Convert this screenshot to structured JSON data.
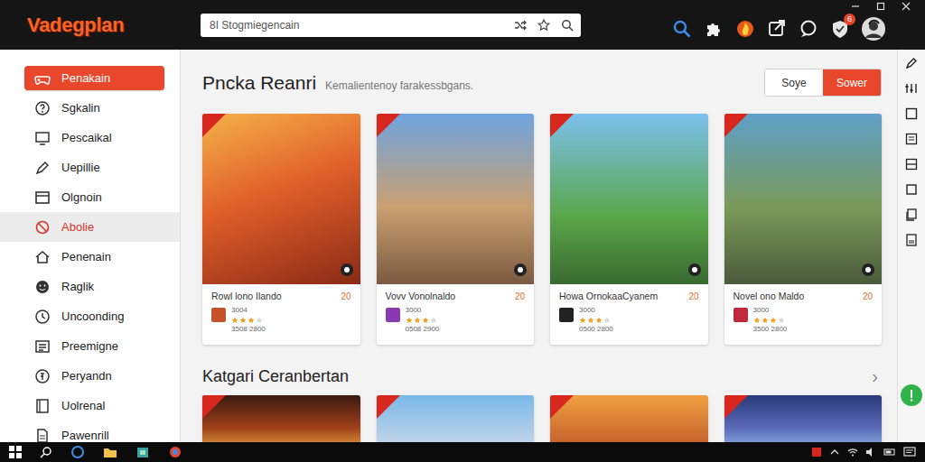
{
  "app": {
    "logo": "Vadegplan"
  },
  "search": {
    "placeholder": "8I Stogmiegencain"
  },
  "toolbar": {
    "badge": "6"
  },
  "sidebar": {
    "items": [
      {
        "label": "Penakain",
        "selected": true,
        "highlighted": false
      },
      {
        "label": "Sgkalin",
        "selected": false,
        "highlighted": false
      },
      {
        "label": "Pescaikal",
        "selected": false,
        "highlighted": false
      },
      {
        "label": "Uepillie",
        "selected": false,
        "highlighted": false
      },
      {
        "label": "Olgnoin",
        "selected": false,
        "highlighted": false
      },
      {
        "label": "Abolie",
        "selected": false,
        "highlighted": true
      },
      {
        "label": "Penenain",
        "selected": false,
        "highlighted": false
      },
      {
        "label": "Raglik",
        "selected": false,
        "highlighted": false
      },
      {
        "label": "Uncoonding",
        "selected": false,
        "highlighted": false
      },
      {
        "label": "Preemigne",
        "selected": false,
        "highlighted": false
      },
      {
        "label": "Peryandn",
        "selected": false,
        "highlighted": false
      },
      {
        "label": "Uolrenal",
        "selected": false,
        "highlighted": false
      },
      {
        "label": "Pawenrill",
        "selected": false,
        "highlighted": false
      }
    ]
  },
  "page": {
    "title": "Pncka Reanri",
    "subtitle": "Kemalientenoy farakessbgans.",
    "buttons": [
      {
        "label": "Soye",
        "selected": false
      },
      {
        "label": "Sower",
        "selected": true
      }
    ]
  },
  "featured": {
    "cards": [
      {
        "name": "Rowl lono Ilando",
        "price": "20",
        "count": "3004",
        "stars": 3,
        "meta": "3508 2800",
        "ribbon": true
      },
      {
        "name": "Vovv Vonolnaldo",
        "price": "20",
        "count": "3000",
        "stars": 3,
        "meta": "0508 2900",
        "ribbon": true
      },
      {
        "name": "Howa OrnokaaCyanem",
        "price": "20",
        "count": "3000",
        "stars": 3,
        "meta": "0500 2800",
        "ribbon": true
      },
      {
        "name": "Novel ono Maldo",
        "price": "20",
        "count": "3000",
        "stars": 3,
        "meta": "3500 2800",
        "ribbon": true
      }
    ]
  },
  "section": {
    "title": "Katgari Ceranbertan",
    "arrow": "›"
  },
  "more": {
    "cards": [
      {
        "ribbon": true
      },
      {
        "ribbon": true
      },
      {
        "ribbon": true
      },
      {
        "ribbon": true
      }
    ]
  }
}
